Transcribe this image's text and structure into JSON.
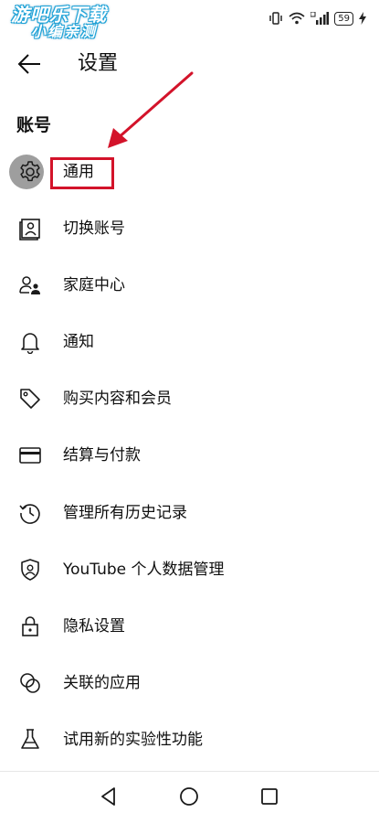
{
  "watermark": {
    "line1": "游吧乐下载",
    "line2": "小编亲测"
  },
  "status": {
    "battery": "59"
  },
  "header": {
    "title": "设置"
  },
  "section": {
    "title": "账号"
  },
  "menu": [
    {
      "label": "通用",
      "icon": "gear-icon"
    },
    {
      "label": "切换账号",
      "icon": "switch-account-icon"
    },
    {
      "label": "家庭中心",
      "icon": "family-icon"
    },
    {
      "label": "通知",
      "icon": "bell-icon"
    },
    {
      "label": "购买内容和会员",
      "icon": "tag-icon"
    },
    {
      "label": "结算与付款",
      "icon": "credit-card-icon"
    },
    {
      "label": "管理所有历史记录",
      "icon": "history-icon"
    },
    {
      "label": "YouTube 个人数据管理",
      "icon": "shield-person-icon"
    },
    {
      "label": "隐私设置",
      "icon": "lock-icon"
    },
    {
      "label": "关联的应用",
      "icon": "linked-circles-icon"
    },
    {
      "label": "试用新的实验性功能",
      "icon": "flask-icon"
    }
  ],
  "annotation": {
    "color": "#d3132a"
  }
}
